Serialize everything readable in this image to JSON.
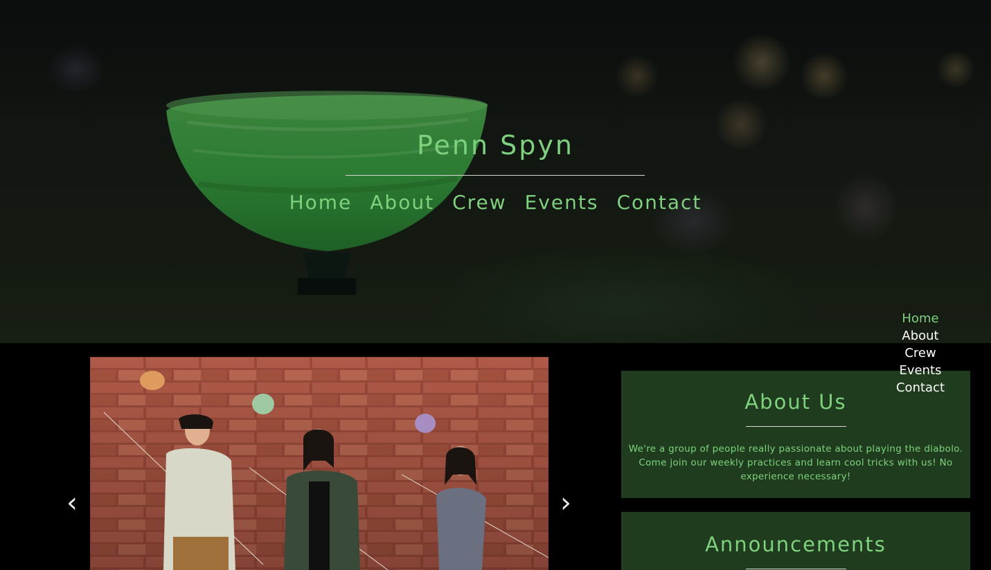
{
  "site": {
    "title": "Penn Spyn"
  },
  "hero_nav": [
    {
      "label": "Home"
    },
    {
      "label": "About"
    },
    {
      "label": "Crew"
    },
    {
      "label": "Events"
    },
    {
      "label": "Contact"
    }
  ],
  "side_menu": [
    {
      "label": "Home",
      "active": true
    },
    {
      "label": "About",
      "active": false
    },
    {
      "label": "Crew",
      "active": false
    },
    {
      "label": "Events",
      "active": false
    },
    {
      "label": "Contact",
      "active": false
    }
  ],
  "carousel": {
    "prev_icon": "chevron-left-icon",
    "next_icon": "chevron-right-icon",
    "prev_glyph": "‹",
    "next_glyph": "›"
  },
  "about": {
    "heading": "About Us",
    "body": "We're a group of people really passionate about playing the diabolo. Come join our weekly practices and learn cool tricks with us! No experience necessary!"
  },
  "announcements": {
    "heading": "Announcements"
  },
  "colors": {
    "accent": "#7ed27e",
    "panel_bg": "#1f3d1e",
    "page_bg": "#000000",
    "rule": "#d8d8d8"
  }
}
